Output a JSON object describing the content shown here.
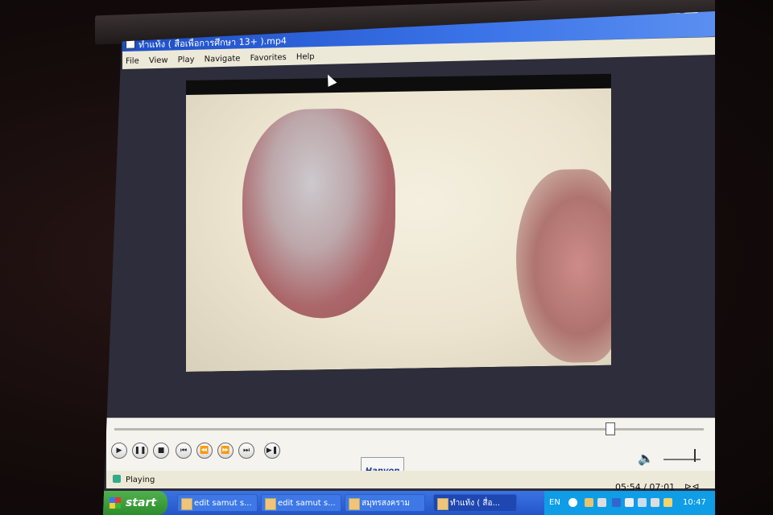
{
  "window": {
    "title": "ทำแท้ง ( สื่อเพื่อการศึกษา 13+ ).mp4"
  },
  "menu": [
    "File",
    "View",
    "Play",
    "Navigate",
    "Favorites",
    "Help"
  ],
  "playback": {
    "status": "Playing",
    "time_display": "05:54 / 07:01",
    "progress_fraction": 0.84
  },
  "controls": {
    "play_icon": "play-icon",
    "pause_icon": "pause-icon",
    "stop_icon": "stop-icon",
    "prev_icon": "previous-icon",
    "rewind_icon": "rewind-icon",
    "forward_icon": "fast-forward-icon",
    "next_icon": "next-icon",
    "step_icon": "step-icon"
  },
  "logo": "Hanvon",
  "taskbar": {
    "start_label": "start",
    "tasks": [
      {
        "label": "edit samut s..."
      },
      {
        "label": "edit samut s..."
      },
      {
        "label": "สมุทรสงคราม"
      },
      {
        "label": "ทำแท้ง ( สื่อ..."
      }
    ],
    "tray_lang": "EN",
    "clock": "10:47"
  },
  "colors": {
    "titlebar": "#2a5fd8",
    "taskbar": "#2456c9",
    "start": "#3a9a38"
  }
}
